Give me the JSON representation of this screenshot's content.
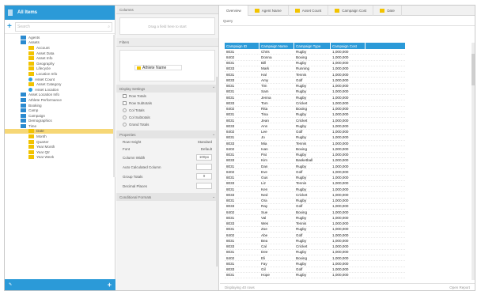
{
  "left": {
    "title": "All Items",
    "search": {
      "placeholder": "Search",
      "icon": "search-icon"
    },
    "tree": [
      {
        "label": "Agents",
        "type": "folder-b",
        "indent": 0
      },
      {
        "label": "Assets",
        "type": "folder-b",
        "indent": 0
      },
      {
        "label": "Account",
        "type": "folder-y",
        "indent": 1
      },
      {
        "label": "Asset Data",
        "type": "folder-y",
        "indent": 1
      },
      {
        "label": "Asset Info",
        "type": "folder-y",
        "indent": 1
      },
      {
        "label": "Geography",
        "type": "folder-y",
        "indent": 1
      },
      {
        "label": "Lifecycle",
        "type": "folder-y",
        "indent": 1
      },
      {
        "label": "Location Info",
        "type": "folder-y",
        "indent": 1
      },
      {
        "label": "Asset Count",
        "type": "dot-b",
        "indent": 1
      },
      {
        "label": "Asset Category",
        "type": "folder-y",
        "indent": 1
      },
      {
        "label": "Asset Location",
        "type": "dot-b",
        "indent": 1
      },
      {
        "label": "Asset Location Info",
        "type": "folder-b",
        "indent": 0
      },
      {
        "label": "Athlete Performance",
        "type": "folder-b",
        "indent": 0
      },
      {
        "label": "Booking",
        "type": "folder-b",
        "indent": 0
      },
      {
        "label": "Camp",
        "type": "folder-b",
        "indent": 0
      },
      {
        "label": "Campaign",
        "type": "folder-b",
        "indent": 0
      },
      {
        "label": "Demographics",
        "type": "folder-b",
        "indent": 0
      },
      {
        "label": "Time",
        "type": "folder-b",
        "indent": 0
      },
      {
        "label": "Date",
        "type": "folder-y",
        "indent": 1,
        "selected": true
      },
      {
        "label": "Month",
        "type": "folder-y",
        "indent": 1
      },
      {
        "label": "Quarter",
        "type": "folder-y",
        "indent": 1
      },
      {
        "label": "Year Month",
        "type": "folder-y",
        "indent": 1
      },
      {
        "label": "Year Qtr",
        "type": "folder-y",
        "indent": 1
      },
      {
        "label": "Year Week",
        "type": "folder-y",
        "indent": 1
      }
    ],
    "footer_plus": "+",
    "footer_icon": "pencil-icon"
  },
  "mid": {
    "columns_header": "Columns",
    "drop_text": "Drag a field here to start",
    "filters_header": "Filters",
    "filter_pill": "Athlete Name",
    "options_header": "Display Settings",
    "options": [
      {
        "label": "Row Totals",
        "kind": "checkbox"
      },
      {
        "label": "Row Subtotals",
        "kind": "checkbox"
      },
      {
        "label": "Col Totals",
        "kind": "radio"
      },
      {
        "label": "Col Subtotals",
        "kind": "radio"
      },
      {
        "label": "Grand Totals",
        "kind": "radio"
      }
    ],
    "props_header": "Properties",
    "kv": [
      {
        "k": "Row Height",
        "v": "Standard"
      },
      {
        "k": "Font",
        "v": "Default"
      }
    ],
    "fields": [
      {
        "label": "Column Width",
        "value": "100px"
      },
      {
        "label": "Auto Calculated Column",
        "value": ""
      },
      {
        "label": "Group Totals",
        "value": "0"
      },
      {
        "label": "Decimal Places",
        "value": ""
      }
    ],
    "bottom_header": "Conditional Formats"
  },
  "right": {
    "tabs": [
      {
        "label": "Overview",
        "icon": false,
        "active": true
      },
      {
        "label": "Agent Name",
        "icon": true
      },
      {
        "label": "Asset Count",
        "icon": true
      },
      {
        "label": "Campaign Cost",
        "icon": true
      },
      {
        "label": "Date",
        "icon": true
      }
    ],
    "toolbar": "Query",
    "columns": [
      "Campaign ID",
      "Campaign Name",
      "Campaign Type",
      "Campaign Cost"
    ],
    "rows": [
      [
        "8031",
        "Chris",
        "Rugby",
        "1,000,000"
      ],
      [
        "8402",
        "Donna",
        "Boxing",
        "1,000,000"
      ],
      [
        "8031",
        "Bill",
        "Rugby",
        "1,000,000"
      ],
      [
        "8033",
        "Mark",
        "Running",
        "1,000,000"
      ],
      [
        "8031",
        "Hal",
        "Tennis",
        "1,000,000"
      ],
      [
        "8033",
        "Amy",
        "Golf",
        "1,000,000"
      ],
      [
        "8031",
        "Tim",
        "Rugby",
        "1,000,000"
      ],
      [
        "8031",
        "Sam",
        "Rugby",
        "1,000,000"
      ],
      [
        "8031",
        "Jenna",
        "Rugby",
        "1,000,000"
      ],
      [
        "8033",
        "Tom",
        "Cricket",
        "1,000,000"
      ],
      [
        "8402",
        "Rita",
        "Boxing",
        "1,000,000"
      ],
      [
        "8031",
        "Tina",
        "Rugby",
        "1,000,000"
      ],
      [
        "8031",
        "Jean",
        "Cricket",
        "1,000,000"
      ],
      [
        "8033",
        "Ann",
        "Rugby",
        "1,000,000"
      ],
      [
        "8402",
        "Lee",
        "Golf",
        "1,000,000"
      ],
      [
        "8031",
        "Jo",
        "Rugby",
        "1,000,000"
      ],
      [
        "8033",
        "Mia",
        "Tennis",
        "1,000,000"
      ],
      [
        "8402",
        "Ivan",
        "Boxing",
        "1,000,000"
      ],
      [
        "8031",
        "Pat",
        "Rugby",
        "1,000,000"
      ],
      [
        "8033",
        "Kim",
        "Basketball",
        "1,000,000"
      ],
      [
        "8031",
        "Dan",
        "Rugby",
        "1,000,000"
      ],
      [
        "8402",
        "Eve",
        "Golf",
        "1,000,000"
      ],
      [
        "8031",
        "Gus",
        "Rugby",
        "1,000,000"
      ],
      [
        "8033",
        "Liz",
        "Tennis",
        "1,000,000"
      ],
      [
        "8031",
        "Ken",
        "Rugby",
        "1,000,000"
      ],
      [
        "8033",
        "Ned",
        "Cricket",
        "1,000,000"
      ],
      [
        "8031",
        "Ora",
        "Rugby",
        "1,000,000"
      ],
      [
        "8033",
        "Ray",
        "Golf",
        "1,000,000"
      ],
      [
        "8402",
        "Sue",
        "Boxing",
        "1,000,000"
      ],
      [
        "8031",
        "Val",
        "Rugby",
        "1,000,000"
      ],
      [
        "8033",
        "Wes",
        "Tennis",
        "1,000,000"
      ],
      [
        "8031",
        "Zoe",
        "Rugby",
        "1,000,000"
      ],
      [
        "8402",
        "Abe",
        "Golf",
        "1,000,000"
      ],
      [
        "8031",
        "Bea",
        "Rugby",
        "1,000,000"
      ],
      [
        "8033",
        "Cal",
        "Cricket",
        "1,000,000"
      ],
      [
        "8031",
        "Dee",
        "Rugby",
        "1,000,000"
      ],
      [
        "8402",
        "Eli",
        "Boxing",
        "1,000,000"
      ],
      [
        "8031",
        "Fay",
        "Rugby",
        "1,000,000"
      ],
      [
        "8033",
        "Gil",
        "Golf",
        "1,000,000"
      ],
      [
        "8031",
        "Hope",
        "Rugby",
        "1,000,000"
      ]
    ],
    "footer_left": "Displaying 40 rows",
    "footer_right": "Open Report"
  },
  "colors": {
    "accent": "#2b9ad8",
    "folder_yellow": "#f2c300",
    "folder_blue": "#2a8ad0",
    "selected_row": "#f6d776"
  }
}
